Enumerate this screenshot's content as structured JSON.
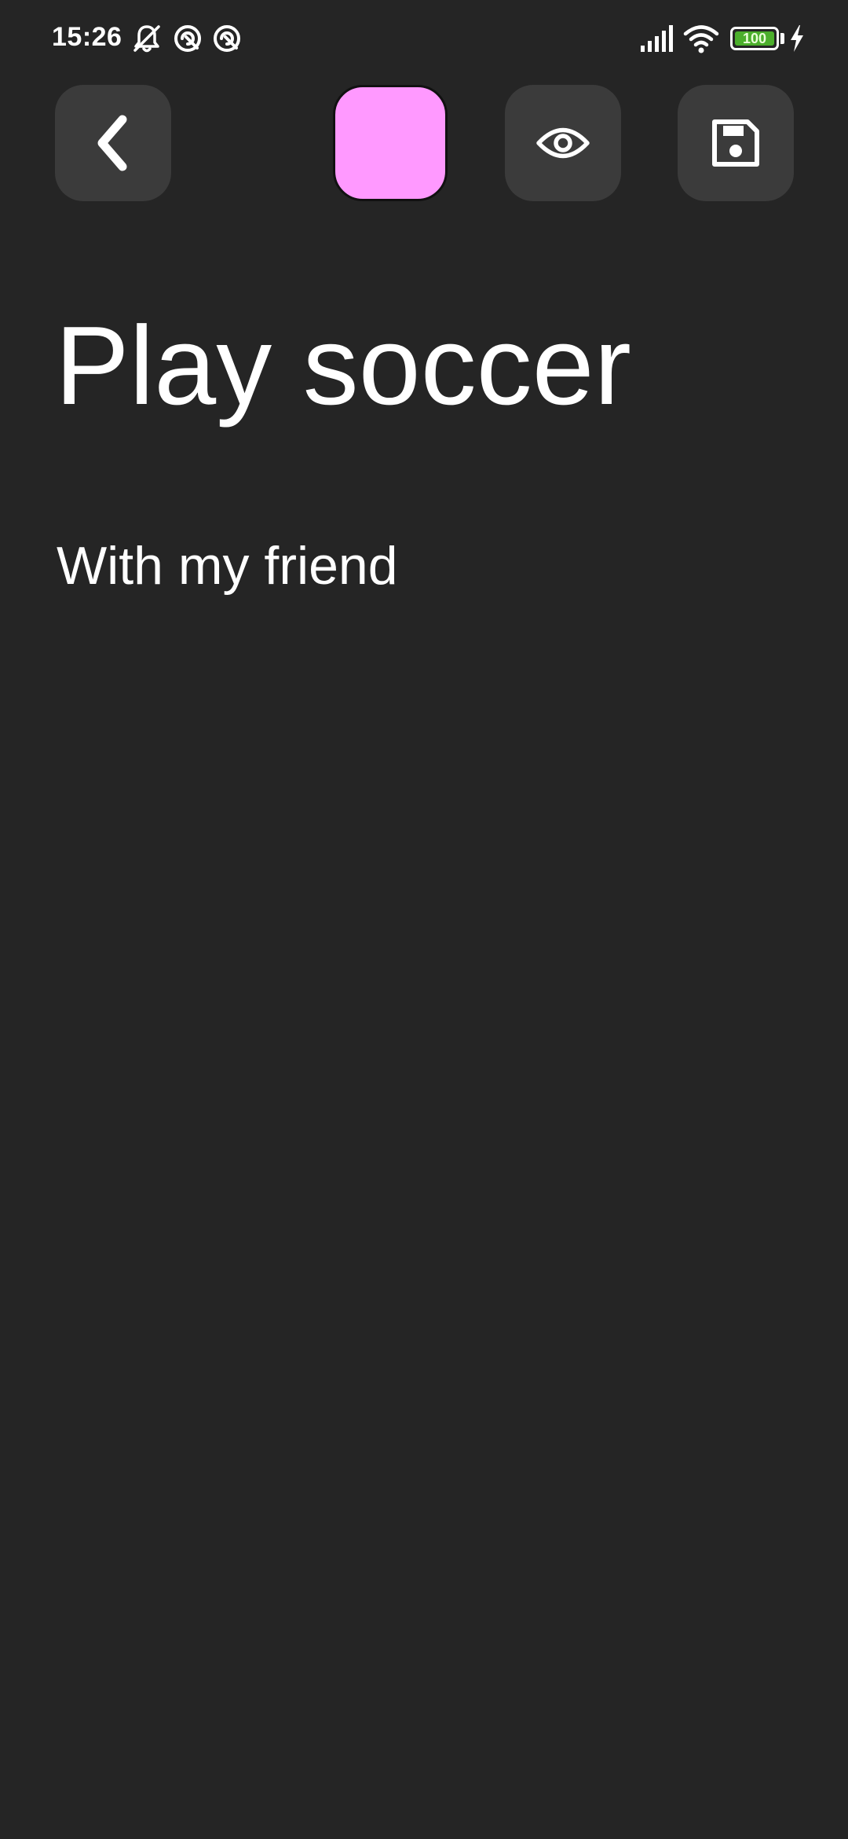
{
  "status_bar": {
    "time": "15:26",
    "battery_level": "100",
    "icons": [
      "bell-off-icon",
      "sync-icon",
      "sync-icon",
      "signal-icon",
      "wifi-icon",
      "battery-icon",
      "charging-icon"
    ]
  },
  "toolbar": {
    "back_icon": "chevron-left-icon",
    "note_color": "#ff99ff",
    "preview_icon": "eye-icon",
    "save_icon": "save-icon"
  },
  "note": {
    "title": "Play soccer",
    "body": "With my friend"
  },
  "colors": {
    "background": "#252525",
    "button_bg": "#3b3b3b",
    "text": "#ffffff",
    "battery_fill": "#4caf2c"
  }
}
